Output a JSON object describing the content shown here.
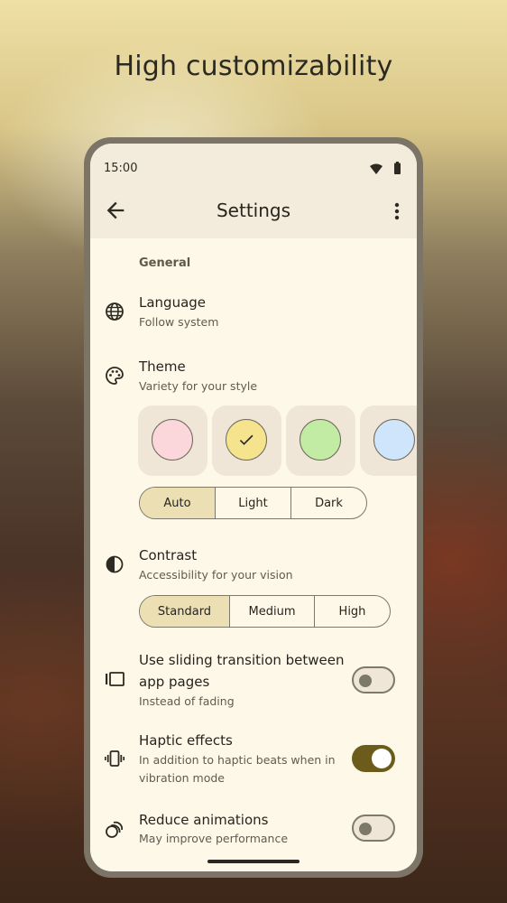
{
  "headline": "High customizability",
  "status_bar": {
    "time": "15:00",
    "icons": [
      "wifi-icon",
      "battery-icon"
    ]
  },
  "app_bar": {
    "title": "Settings",
    "icons": [
      "back-arrow-icon",
      "more-vert-icon"
    ]
  },
  "general": {
    "section_title": "General",
    "language": {
      "title": "Language",
      "subtitle": "Follow system",
      "icon": "globe-icon"
    },
    "theme": {
      "title": "Theme",
      "subtitle": "Variety for your style",
      "icon": "palette-icon",
      "swatches": [
        {
          "color": "#fbd6da",
          "selected": false
        },
        {
          "color": "#f6e38e",
          "selected": true
        },
        {
          "color": "#c2eca4",
          "selected": false
        },
        {
          "color": "#cfe5fc",
          "selected": false
        }
      ],
      "modes": [
        "Auto",
        "Light",
        "Dark"
      ],
      "selected_mode": "Auto"
    },
    "contrast": {
      "title": "Contrast",
      "subtitle": "Accessibility for your vision",
      "icon": "contrast-icon",
      "options": [
        "Standard",
        "Medium",
        "High"
      ],
      "selected_option": "Standard"
    },
    "sliding_transition": {
      "title_line1": "Use sliding transition between",
      "title_line2": "app pages",
      "subtitle": "Instead of fading",
      "icon": "view-carousel-icon",
      "enabled": false
    },
    "haptic": {
      "title": "Haptic effects",
      "subtitle_line1": "In addition to haptic beats when in",
      "subtitle_line2": "vibration mode",
      "icon": "vibration-icon",
      "enabled": true
    },
    "reduce_animations": {
      "title": "Reduce animations",
      "subtitle": "May improve performance",
      "icon": "animation-icon",
      "enabled": false
    }
  },
  "colors": {
    "accent": "#6b5c1c",
    "surface": "#fdf8e8",
    "appbar": "#f3ebdb",
    "selected_segment": "#ebdfb3"
  }
}
